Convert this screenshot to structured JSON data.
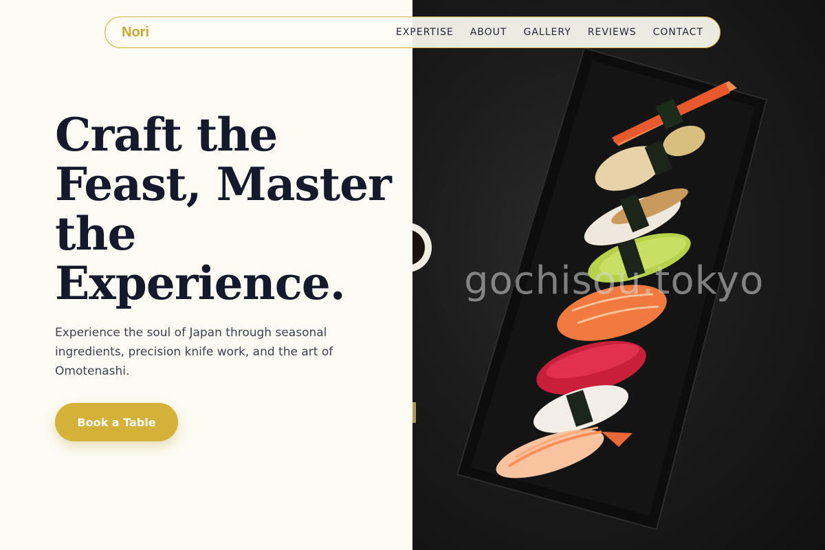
{
  "nav": {
    "brand": "Nori",
    "links": [
      {
        "label": "EXPERTISE"
      },
      {
        "label": "ABOUT"
      },
      {
        "label": "GALLERY"
      },
      {
        "label": "REVIEWS"
      },
      {
        "label": "CONTACT"
      }
    ]
  },
  "hero": {
    "title_lines": [
      "Craft the",
      "Feast, Master",
      "the",
      "Experience."
    ],
    "description": "Experience the soul of Japan through seasonal ingredients, precision knife work, and the art of Omotenashi.",
    "cta_label": "Book a Table"
  },
  "image": {
    "watermark": "gochisou.tokyo"
  },
  "colors": {
    "accent": "#d4b23a",
    "background": "#fdfcf4",
    "heading": "#141a2b"
  }
}
